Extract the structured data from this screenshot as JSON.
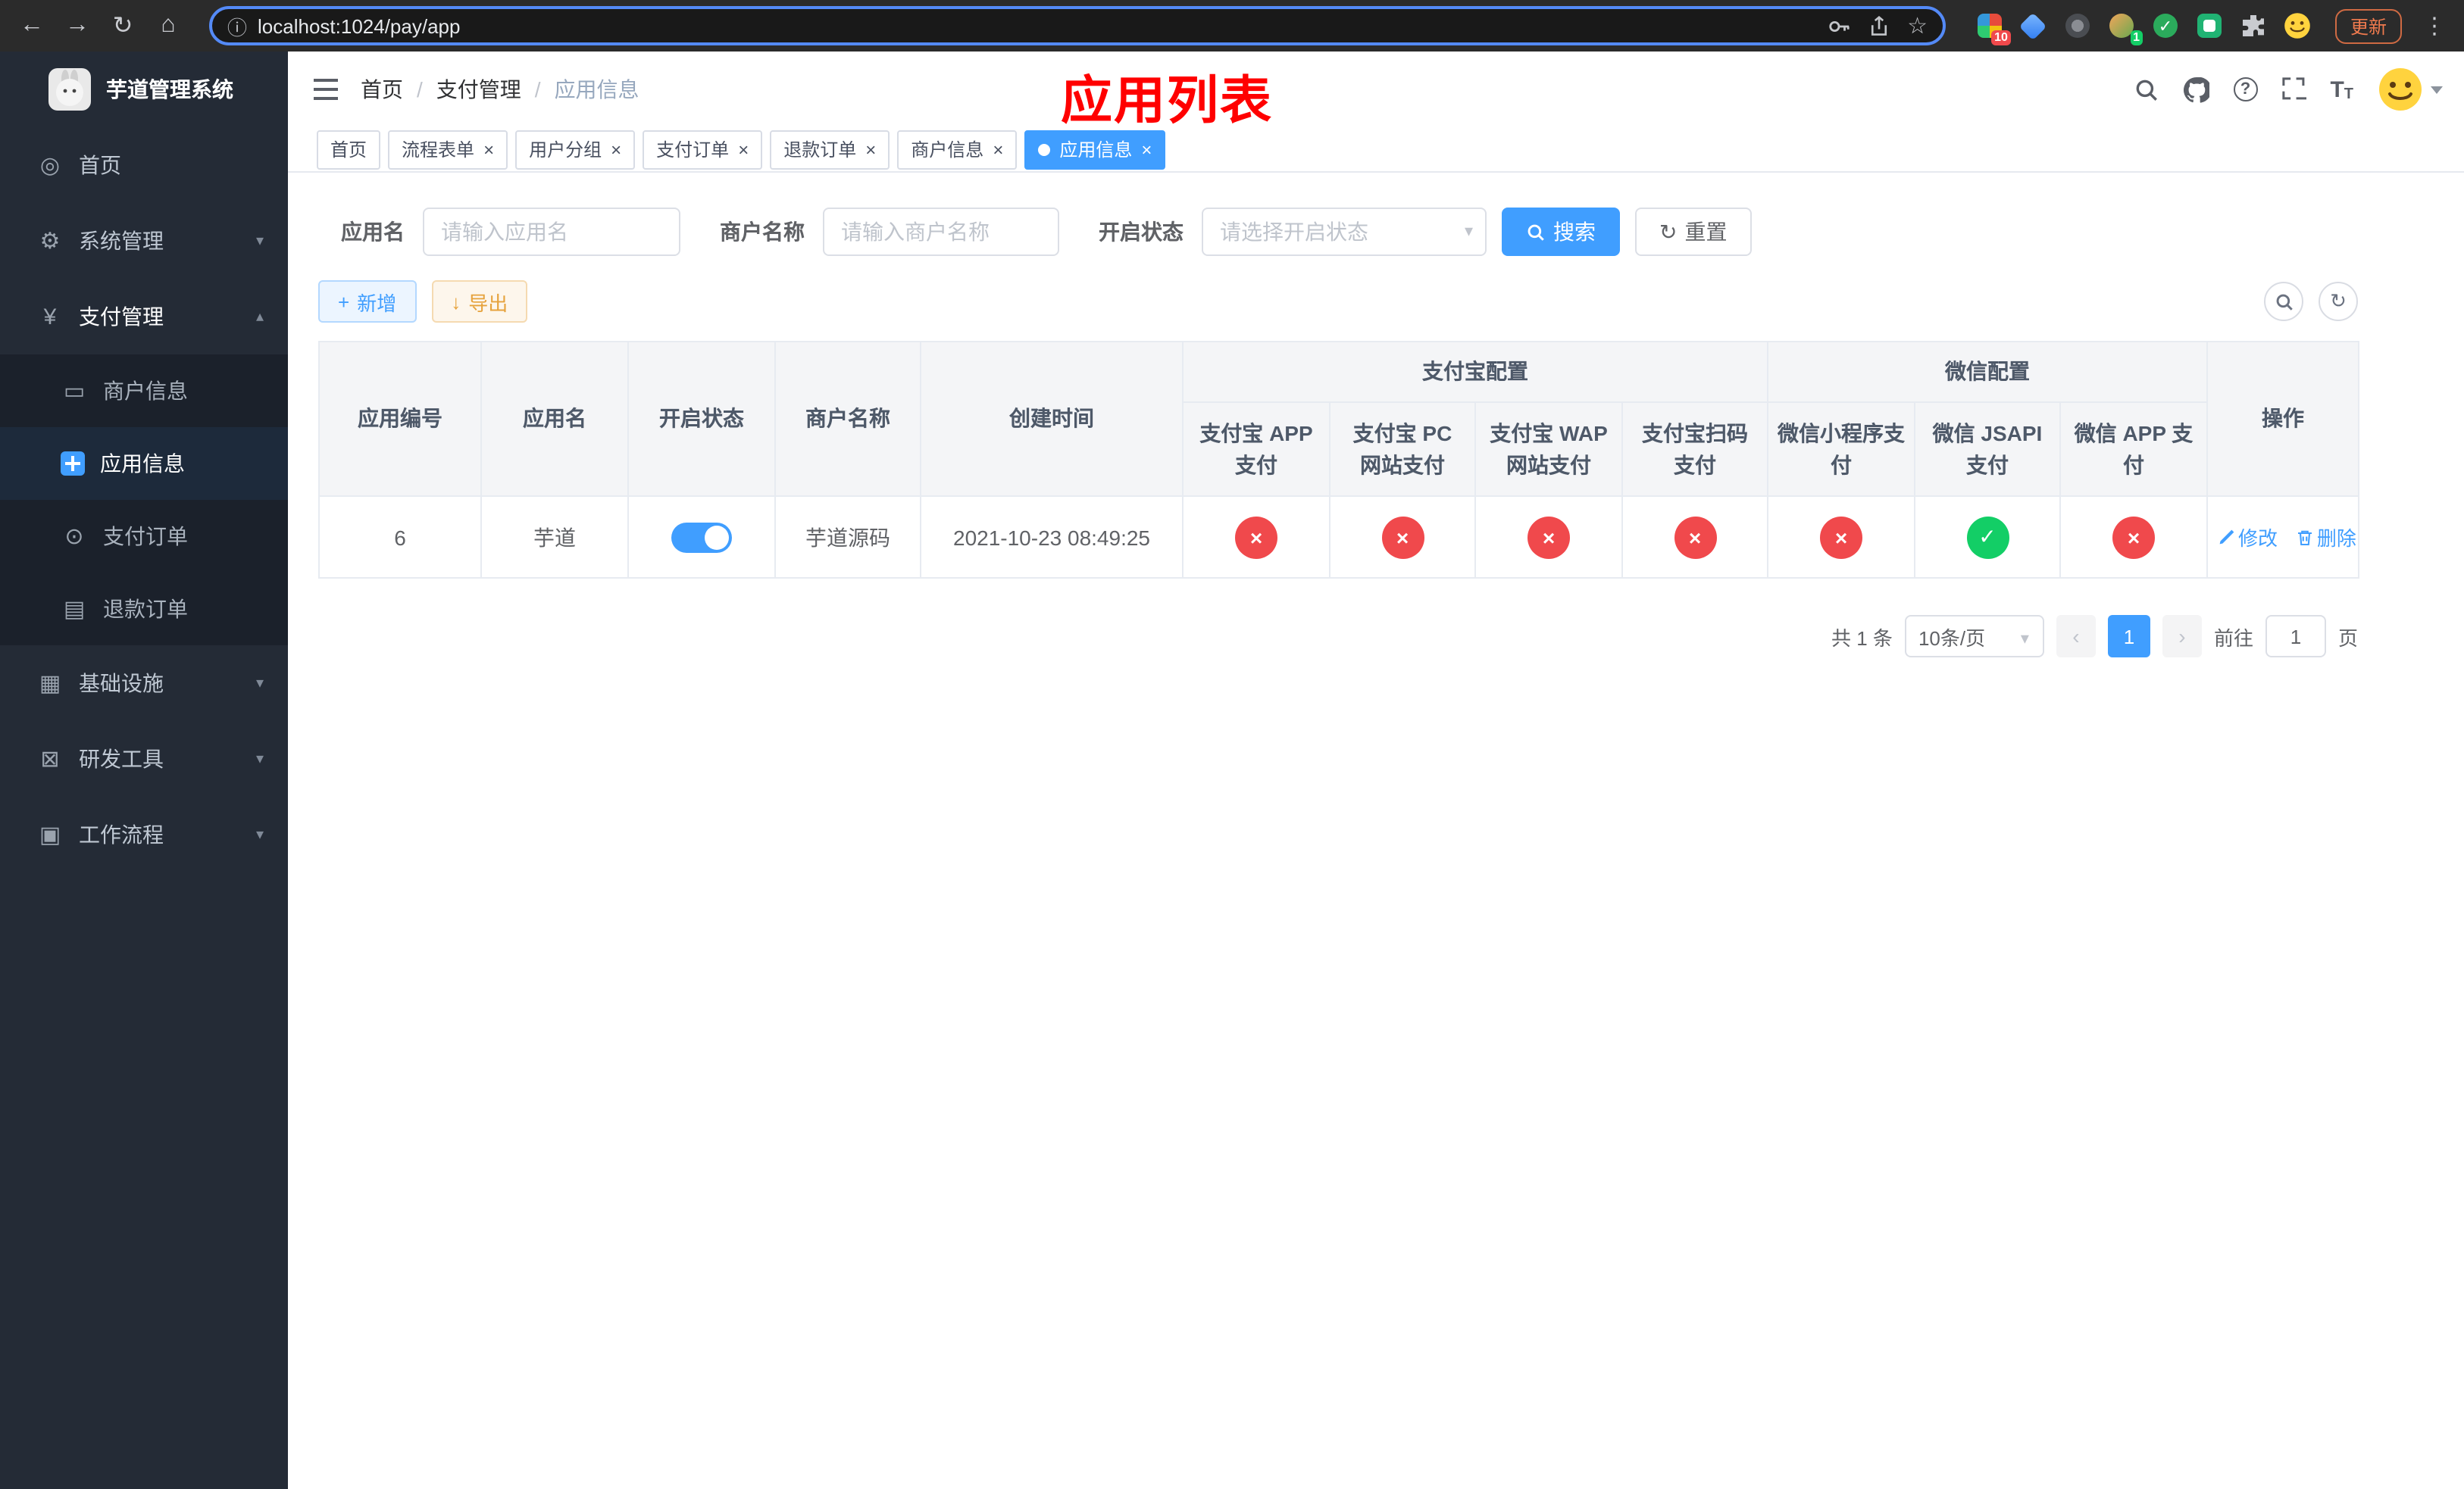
{
  "colors": {
    "accent": "#409eff",
    "danger": "#f0494c",
    "success": "#13ce66",
    "annotation": "#ff0000",
    "warning": "#e6a23c"
  },
  "browser": {
    "url": "localhost:1024/pay/app",
    "update_label": "更新",
    "extension_badges": {
      "grid": "10",
      "avatar": "1"
    }
  },
  "sidebar": {
    "app_title": "芋道管理系统",
    "items": [
      {
        "label": "首页"
      },
      {
        "label": "系统管理"
      },
      {
        "label": "支付管理"
      },
      {
        "label": "商户信息"
      },
      {
        "label": "应用信息"
      },
      {
        "label": "支付订单"
      },
      {
        "label": "退款订单"
      },
      {
        "label": "基础设施"
      },
      {
        "label": "研发工具"
      },
      {
        "label": "工作流程"
      }
    ]
  },
  "header": {
    "breadcrumb": [
      "首页",
      "支付管理",
      "应用信息"
    ],
    "annotation": "应用列表"
  },
  "tabs": [
    {
      "label": "首页",
      "active": false,
      "closable": false
    },
    {
      "label": "流程表单",
      "active": false,
      "closable": true
    },
    {
      "label": "用户分组",
      "active": false,
      "closable": true
    },
    {
      "label": "支付订单",
      "active": false,
      "closable": true
    },
    {
      "label": "退款订单",
      "active": false,
      "closable": true
    },
    {
      "label": "商户信息",
      "active": false,
      "closable": true
    },
    {
      "label": "应用信息",
      "active": true,
      "closable": true
    }
  ],
  "filters": {
    "app_name_label": "应用名",
    "app_name_placeholder": "请输入应用名",
    "merchant_name_label": "商户名称",
    "merchant_name_placeholder": "请输入商户名称",
    "status_label": "开启状态",
    "status_placeholder": "请选择开启状态",
    "search_button": "搜索",
    "reset_button": "重置"
  },
  "toolbar": {
    "add_button": "新增",
    "export_button": "导出"
  },
  "table": {
    "groups": [
      "支付宝配置",
      "微信配置"
    ],
    "columns": [
      "应用编号",
      "应用名",
      "开启状态",
      "商户名称",
      "创建时间",
      "支付宝 APP 支付",
      "支付宝 PC 网站支付",
      "支付宝 WAP 网站支付",
      "支付宝扫码支付",
      "微信小程序支付",
      "微信 JSAPI 支付",
      "微信 APP 支付",
      "操作"
    ],
    "row": {
      "id": "6",
      "name": "芋道",
      "enabled": true,
      "merchant": "芋道源码",
      "create_time": "2021-10-23 08:49:25",
      "statuses": [
        false,
        false,
        false,
        false,
        false,
        true,
        false
      ]
    },
    "enabled_glyph": "✓",
    "disabled_glyph": "×",
    "edit_button": "修改",
    "delete_button": "删除"
  },
  "pagination": {
    "total_text": "共 1 条",
    "page_size_text": "10条/页",
    "page": "1",
    "prev_glyph": "‹",
    "next_glyph": "›",
    "goto_label": "前往",
    "goto_value": "1",
    "goto_unit": "页"
  }
}
